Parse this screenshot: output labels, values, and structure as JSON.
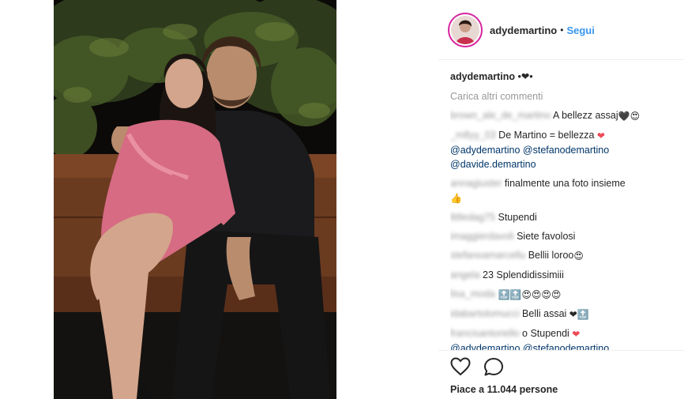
{
  "post": {
    "username": "adydemartino",
    "separator": "•",
    "follow_label": "Segui",
    "caption": "•❤•",
    "load_more": "Carica altri commenti",
    "likes": "Piace a 11.044 persone"
  },
  "comments": [
    {
      "user": "brown_ale_de_martino",
      "text": "A bellezz assaj",
      "emoji": "🖤😍"
    },
    {
      "user": "_m8yy_03",
      "text": "De Martino = bellezza",
      "emoji": "❤"
    },
    {
      "mentions": "@adydemartino @stefanodemartino"
    },
    {
      "mentions": "@davide.demartino"
    },
    {
      "user": "annagiuster",
      "text": "finalmente una foto insieme",
      "emoji": "👍"
    },
    {
      "user": "littledag75",
      "text": "Stupendi"
    },
    {
      "user": "imaggierdavoli",
      "text": "Siete favolosi"
    },
    {
      "user": "stefanoamarcellu",
      "text": "Bellii loroo",
      "emoji": "😍"
    },
    {
      "user": "angela",
      "text": "23 Splendidissimiii"
    },
    {
      "user": "lisa_moda",
      "emoji": "🔝🔝😍😍😍😍"
    },
    {
      "user": "idabartolomucci",
      "text": "Belli assai",
      "emoji": "❤🔝"
    },
    {
      "user": "francisantoriello",
      "text": "o Stupendi",
      "emoji": "❤"
    },
    {
      "mentions": "@adydemartino @stefanodemartino"
    }
  ],
  "icons": {
    "like": "heart-outline-icon",
    "comment": "comment-bubble-icon"
  },
  "colors": {
    "link": "#3897f0",
    "mention": "#003569",
    "heart": "#ed4956",
    "avatar_ring": "#d6249f"
  }
}
